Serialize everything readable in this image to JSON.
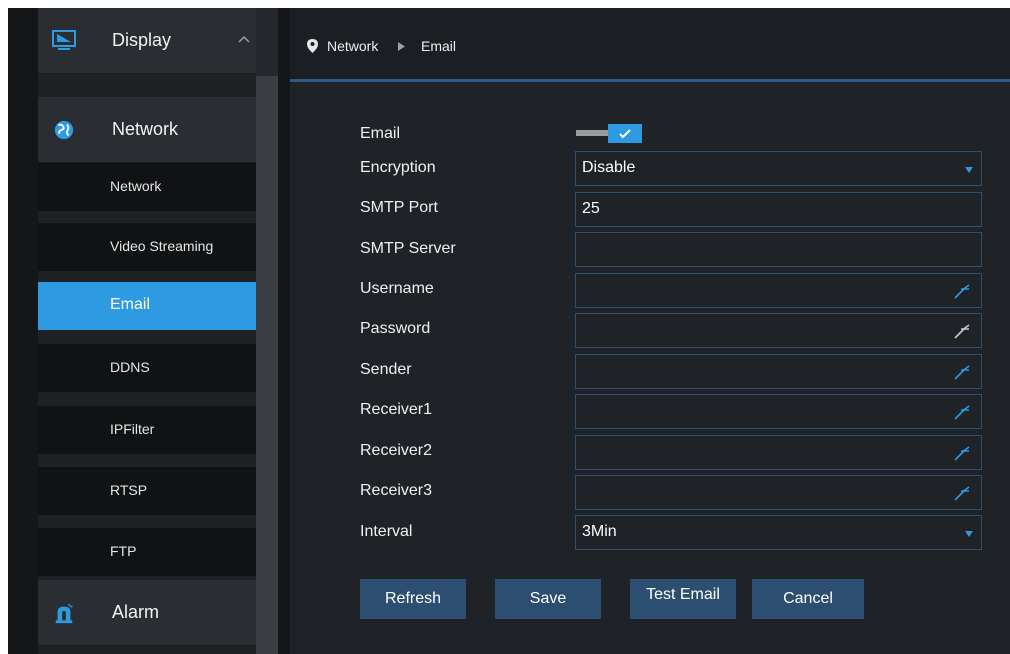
{
  "sidebar": {
    "categories": [
      {
        "label": "Display"
      },
      {
        "label": "Network"
      },
      {
        "label": "Alarm"
      }
    ],
    "items": [
      {
        "label": "Network"
      },
      {
        "label": "Video Streaming"
      },
      {
        "label": "Email"
      },
      {
        "label": "DDNS"
      },
      {
        "label": "IPFilter"
      },
      {
        "label": "RTSP"
      },
      {
        "label": "FTP"
      }
    ],
    "active_item": "Email"
  },
  "breadcrumb": {
    "section": "Network",
    "page": "Email"
  },
  "form": {
    "email_label": "Email",
    "email_enabled": true,
    "encryption_label": "Encryption",
    "encryption_value": "Disable",
    "smtp_port_label": "SMTP Port",
    "smtp_port_value": "25",
    "smtp_server_label": "SMTP Server",
    "smtp_server_value": "",
    "username_label": "Username",
    "password_label": "Password",
    "sender_label": "Sender",
    "receiver1_label": "Receiver1",
    "receiver2_label": "Receiver2",
    "receiver3_label": "Receiver3",
    "interval_label": "Interval",
    "interval_value": "3Min"
  },
  "buttons": {
    "refresh": "Refresh",
    "save": "Save",
    "test_email": "Test Email",
    "cancel": "Cancel"
  },
  "colors": {
    "accent": "#2d9ae1",
    "button": "#2c4f71",
    "sidebar_active": "#2d9ae1",
    "field_border": "#2d4f70"
  },
  "icons": [
    "monitor-icon",
    "globe-icon",
    "alarm-bell-icon",
    "location-pin-icon",
    "breadcrumb-arrow-icon",
    "key-icon",
    "dropdown-icon",
    "chevron-up-icon",
    "check-icon"
  ]
}
